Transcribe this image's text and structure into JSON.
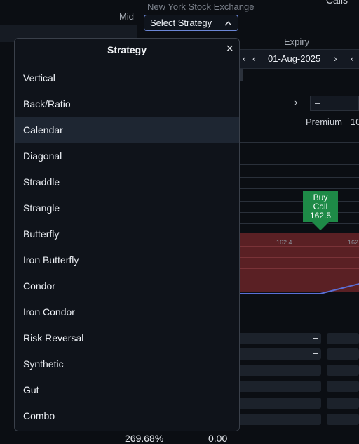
{
  "background": {
    "calls_label": "Calls",
    "mid_label": "Mid",
    "exchange": "New York Stock Exchange",
    "select_strategy": "Select Strategy",
    "expiry_label": "Expiry",
    "expiry_date": "01-Aug-2025",
    "premium_label": "Premium",
    "premium_value": "10",
    "buy_badge": {
      "line1": "Buy",
      "line2": "Call",
      "line3": "162.5"
    },
    "axis_labels": [
      "162.4",
      "162"
    ],
    "footer_pct": "269.68%",
    "footer_value": "0.00",
    "dash": "–"
  },
  "popup": {
    "title": "Strategy",
    "close": "×",
    "items": [
      "Vertical",
      "Back/Ratio",
      "Calendar",
      "Diagonal",
      "Straddle",
      "Strangle",
      "Butterfly",
      "Iron Butterfly",
      "Condor",
      "Iron Condor",
      "Risk Reversal",
      "Synthetic",
      "Gut",
      "Combo"
    ],
    "selected": "Calendar"
  },
  "colors": {
    "accent": "#6b86d6",
    "buy": "#1e8a47",
    "loss_band": "#5a2024",
    "selected_row": "#1e2632"
  }
}
